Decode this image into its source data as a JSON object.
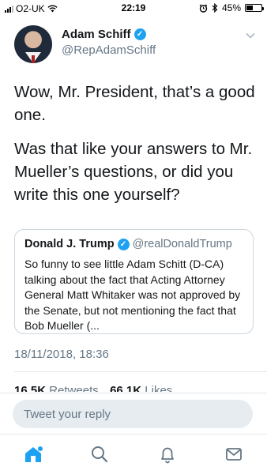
{
  "status_bar": {
    "carrier": "O2-UK",
    "time": "22:19",
    "battery": "45%",
    "battery_level": 0.45
  },
  "tweet": {
    "author_name": "Adam Schiff",
    "author_handle": "@RepAdamSchiff",
    "text_paragraphs": [
      "Wow, Mr. President, that’s a good one.",
      "Was that like your answers to Mr. Mueller’s questions, or did you write this one yourself?"
    ],
    "timestamp": "18/11/2018, 18:36",
    "retweets_count": "16.5K",
    "retweets_label": "Retweets",
    "likes_count": "66.1K",
    "likes_label": "Likes"
  },
  "quoted_tweet": {
    "author_name": "Donald J. Trump",
    "author_handle": "@realDonaldTrump",
    "text": "So funny to see little Adam Schitt (D-CA) talking about the fact that Acting Attorney General Matt Whitaker was not approved by the Senate, but not mentioning the fact that Bob Mueller (..."
  },
  "reply": {
    "placeholder": "Tweet your reply"
  },
  "tab_bar": {
    "items": [
      "home-icon",
      "search-icon",
      "notifications-icon",
      "messages-icon"
    ],
    "accent": "#1da1f2",
    "inactive": "#657786"
  }
}
